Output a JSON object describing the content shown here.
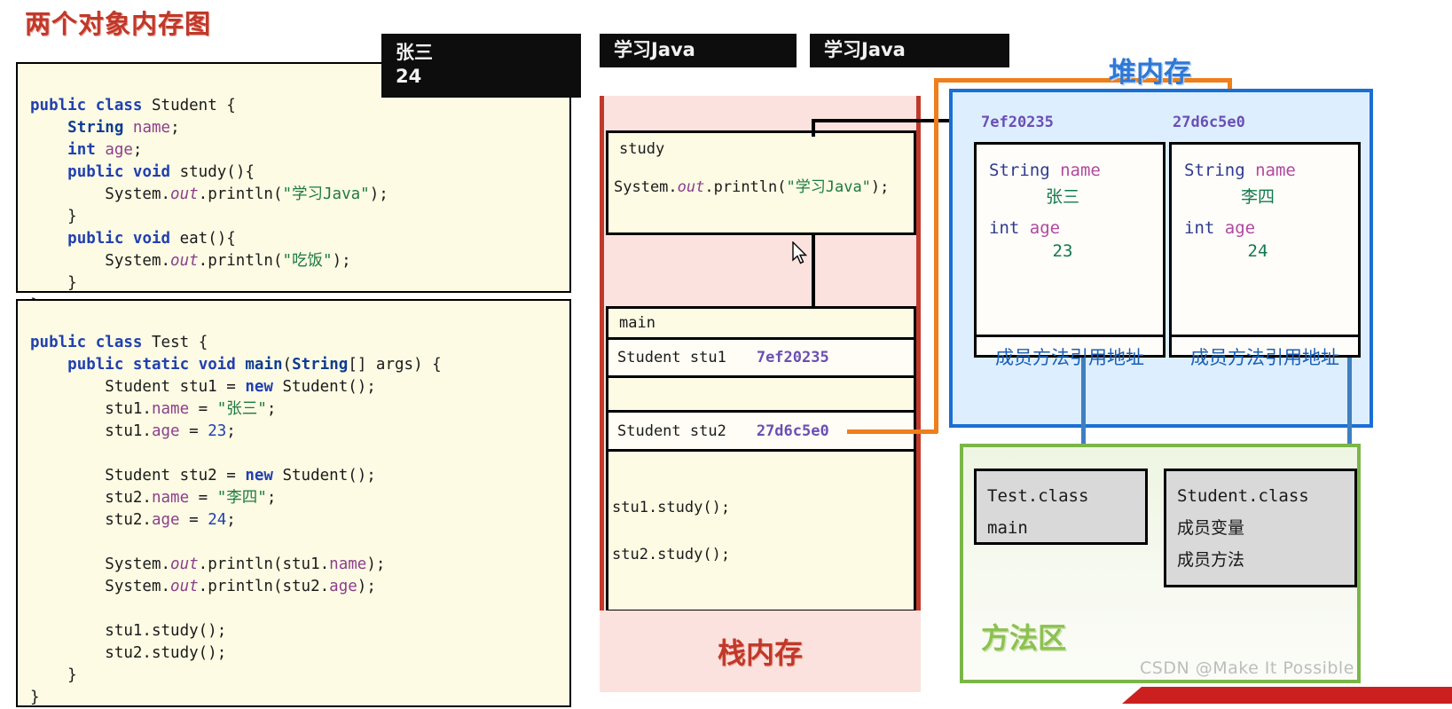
{
  "page_title": "两个对象内存图",
  "code_panels": [
    {
      "name": "student-class",
      "lines": [
        "public class Student {",
        "    String name;",
        "    int age;",
        "    public void study(){",
        "        System.out.println(\"学习Java\");",
        "    }",
        "    public void eat(){",
        "        System.out.println(\"吃饭\");",
        "    }",
        "}"
      ]
    },
    {
      "name": "test-class",
      "lines": [
        "public class Test {",
        "    public static void main(String[] args) {",
        "        Student stu1 = new Student();",
        "        stu1.name = \"张三\";",
        "        stu1.age = 23;",
        "",
        "        Student stu2 = new Student();",
        "        stu2.name = \"李四\";",
        "        stu2.age = 24;",
        "",
        "        System.out.println(stu1.name);",
        "        System.out.println(stu2.age);",
        "",
        "        stu1.study();",
        "        stu2.study();",
        "    }",
        "}"
      ]
    }
  ],
  "consoles": [
    {
      "name": "console-output-1",
      "line1": "张三",
      "line2": "24"
    },
    {
      "name": "console-output-2",
      "line1": "学习Java",
      "line2": ""
    },
    {
      "name": "console-output-3",
      "line1": "学习Java",
      "line2": ""
    }
  ],
  "stack": {
    "label": "栈内存",
    "frames": [
      {
        "name": "study-frame",
        "title": "study",
        "body": "System.out.println(\"学习Java\");"
      },
      {
        "name": "main-frame",
        "title": "main",
        "variables": [
          {
            "decl": "Student stu1",
            "address": "7ef20235"
          },
          {
            "decl": "Student stu2",
            "address": "27d6c5e0"
          }
        ],
        "calls": [
          "stu1.study();",
          "stu2.study();"
        ]
      }
    ]
  },
  "heap": {
    "label": "堆内存",
    "objects": [
      {
        "name": "object-stu1",
        "address": "7ef20235",
        "fields": [
          {
            "type": "String",
            "field": "name",
            "value": "张三"
          },
          {
            "type": "int",
            "field": "age",
            "value": "23"
          }
        ],
        "method_ref": "成员方法引用地址"
      },
      {
        "name": "object-stu2",
        "address": "27d6c5e0",
        "fields": [
          {
            "type": "String",
            "field": "name",
            "value": "李四"
          },
          {
            "type": "int",
            "field": "age",
            "value": "24"
          }
        ],
        "method_ref": "成员方法引用地址"
      }
    ]
  },
  "method_area": {
    "label": "方法区",
    "classes": [
      {
        "name": "test-class-entry",
        "title": "Test.class",
        "items": [
          "main"
        ]
      },
      {
        "name": "student-class-entry",
        "title": "Student.class",
        "items": [
          "成员变量",
          "成员方法"
        ]
      }
    ]
  },
  "watermark": "CSDN @Make It Possible",
  "bottom_bar_text": "",
  "colors": {
    "title_red": "#c0392b",
    "heap_blue": "#1a6fd4",
    "method_green": "#7ab648",
    "orange_connector": "#ee7f1b",
    "blue_connector": "#3f7fc1",
    "address_purple": "#6a4fb5",
    "string_green": "#127a4a"
  }
}
